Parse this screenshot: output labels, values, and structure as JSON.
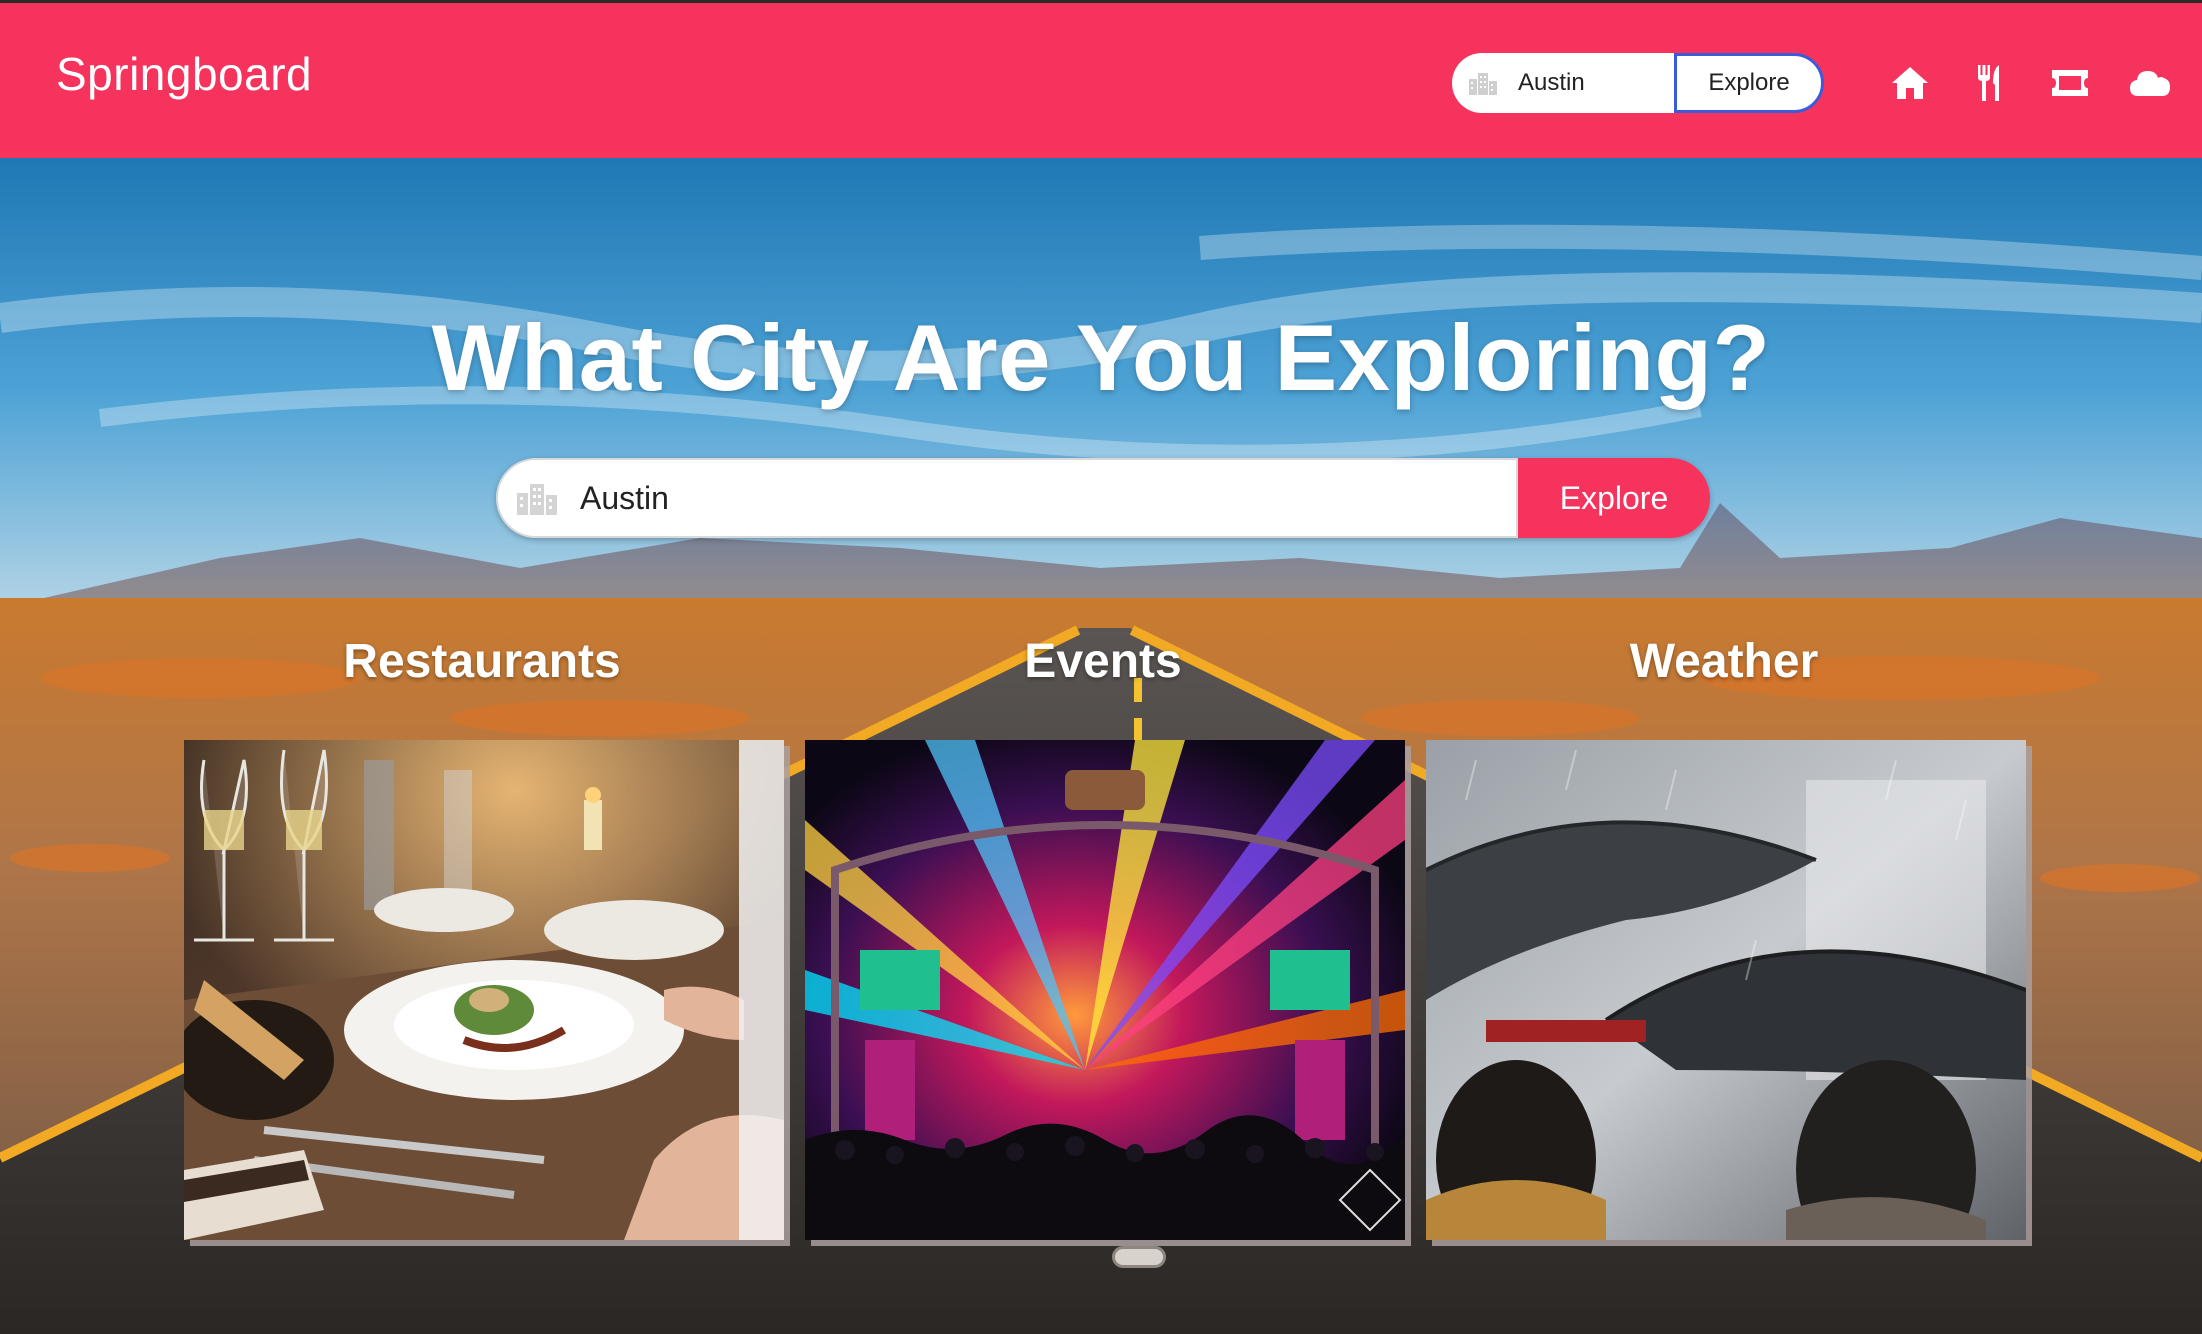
{
  "app": {
    "brand": "Springboard"
  },
  "nav": {
    "search_value": "Austin",
    "explore_label": "Explore",
    "icons": [
      "home-icon",
      "restaurant-icon",
      "ticket-icon",
      "cloud-icon"
    ]
  },
  "hero": {
    "title": "What City Are You Exploring?",
    "search_value": "Austin",
    "explore_label": "Explore"
  },
  "sections": [
    {
      "label": "Restaurants",
      "image": "dinner table with wine glasses and plated food"
    },
    {
      "label": "Events",
      "image": "concert stage with colorful lights and crowd"
    },
    {
      "label": "Weather",
      "image": "people holding umbrellas in the rain"
    }
  ],
  "colors": {
    "accent": "#f5335c",
    "focus_border": "#3b5bdb",
    "text_light": "#ffffff"
  }
}
